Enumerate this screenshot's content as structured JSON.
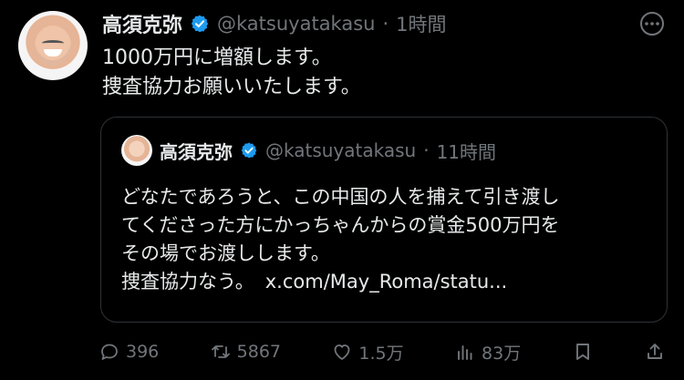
{
  "tweet": {
    "author_name": "高須克弥",
    "author_handle": "@katsuyatakasu",
    "dot": "·",
    "time": "1時間",
    "lines": [
      "1000万円に増額します。",
      "捜査協力お願いいたします。"
    ]
  },
  "quote": {
    "author_name": "高須克弥",
    "author_handle": "@katsuyatakasu",
    "dot": "·",
    "time": "11時間",
    "lines": [
      "どなたであろうと、この中国の人を捕えて引き渡し",
      "てくださった方にかっちゃんからの賞金500万円を",
      "その場でお渡しします。"
    ],
    "last_line_text": "捜査協力なう。",
    "link_text": "x.com/May_Roma/statu..."
  },
  "actions": {
    "reply_count": "396",
    "retweet_count": "5867",
    "like_count": "1.5万",
    "views_count": "83万"
  },
  "icons": {
    "verified": "verified-check-icon",
    "more": "more-options-icon",
    "reply": "reply-icon",
    "retweet": "retweet-icon",
    "like": "heart-icon",
    "views": "views-icon",
    "bookmark": "bookmark-icon",
    "share": "share-icon"
  },
  "colors": {
    "background": "#000000",
    "text_primary": "#e7e9ea",
    "text_secondary": "#71767b",
    "border": "#2f3336",
    "verified_blue": "#1d9bf0"
  }
}
